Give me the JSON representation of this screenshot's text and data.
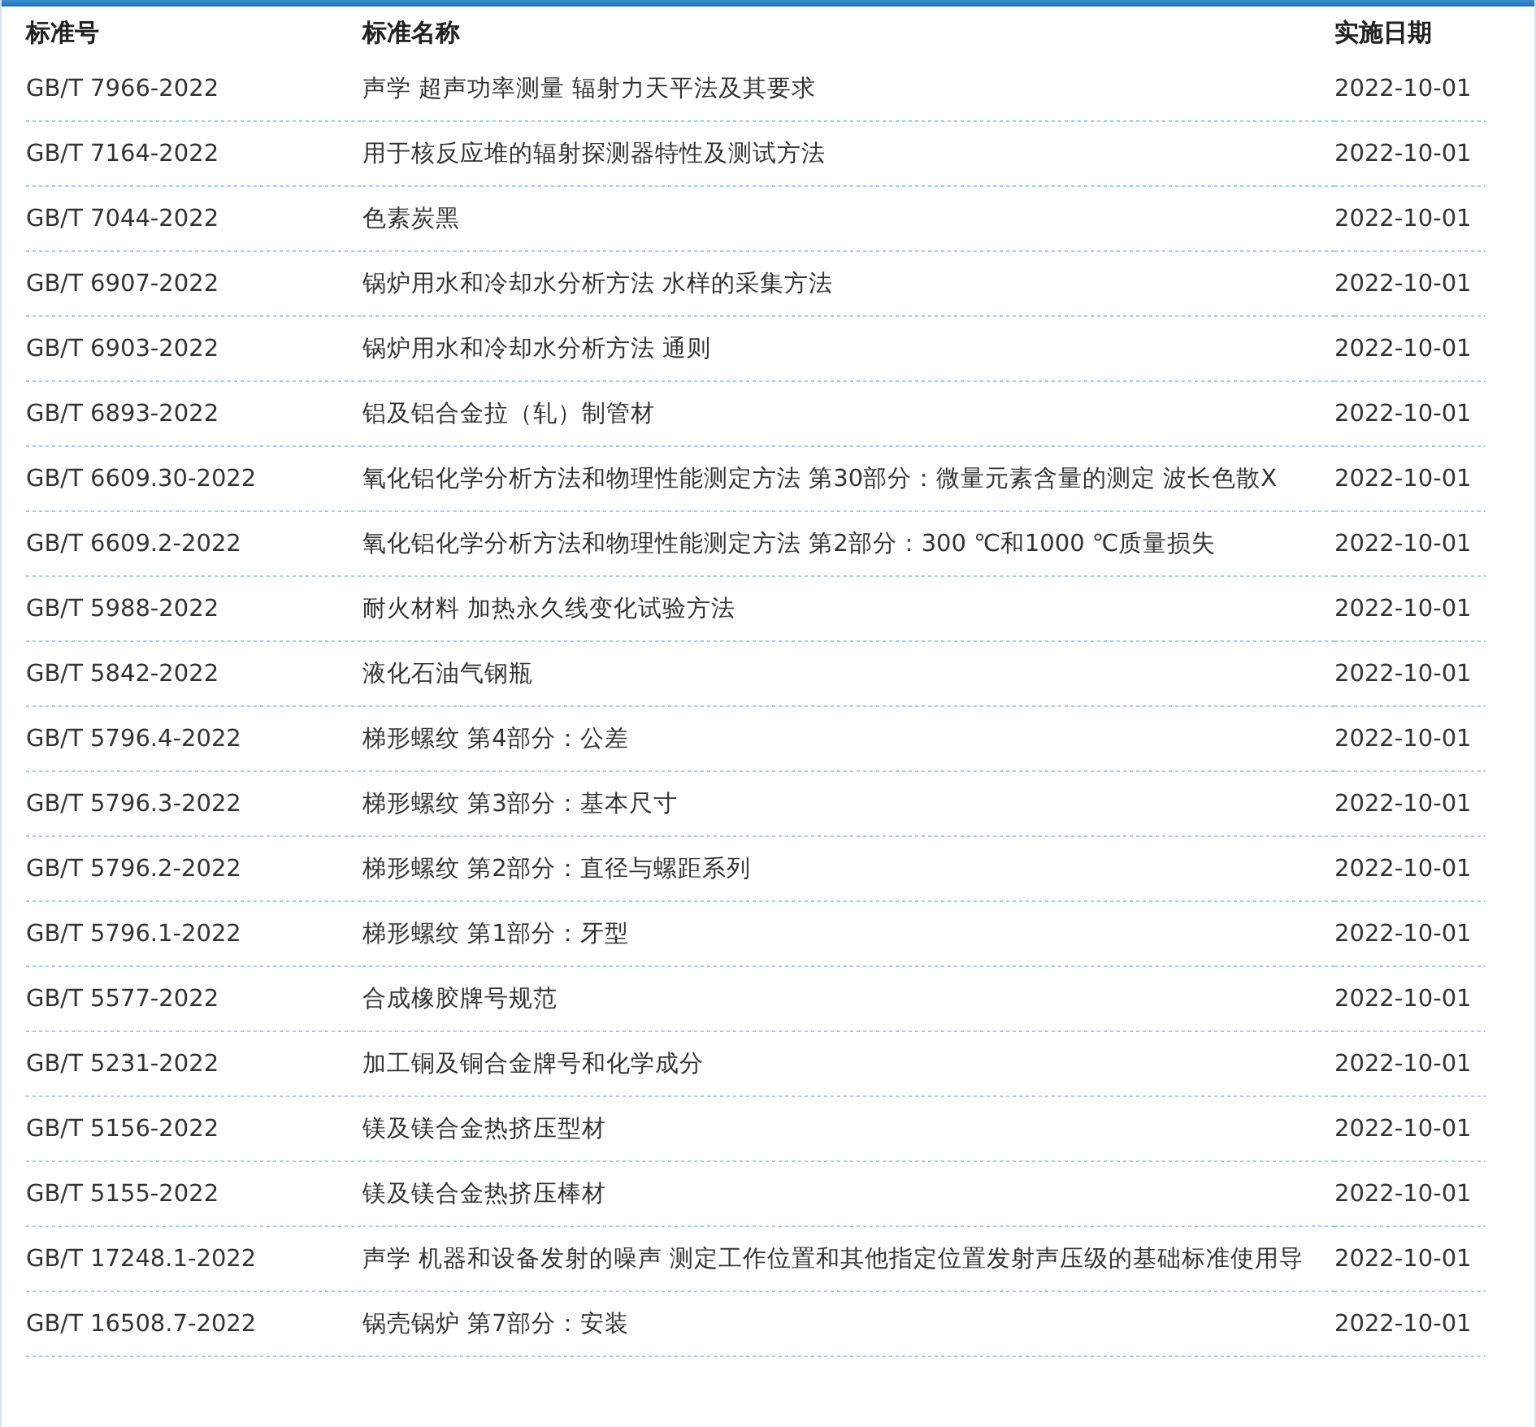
{
  "table": {
    "columns": [
      "标准号",
      "标准名称",
      "实施日期"
    ],
    "rows": [
      {
        "code": "GB/T 7966-2022",
        "name": "声学 超声功率测量 辐射力天平法及其要求",
        "date": "2022-10-01"
      },
      {
        "code": "GB/T 7164-2022",
        "name": "用于核反应堆的辐射探测器特性及测试方法",
        "date": "2022-10-01"
      },
      {
        "code": "GB/T 7044-2022",
        "name": "色素炭黑",
        "date": "2022-10-01"
      },
      {
        "code": "GB/T 6907-2022",
        "name": "锅炉用水和冷却水分析方法 水样的采集方法",
        "date": "2022-10-01"
      },
      {
        "code": "GB/T 6903-2022",
        "name": "锅炉用水和冷却水分析方法 通则",
        "date": "2022-10-01"
      },
      {
        "code": "GB/T 6893-2022",
        "name": "铝及铝合金拉（轧）制管材",
        "date": "2022-10-01"
      },
      {
        "code": "GB/T 6609.30-2022",
        "name": "氧化铝化学分析方法和物理性能测定方法 第30部分：微量元素含量的测定 波长色散X",
        "date": "2022-10-01"
      },
      {
        "code": "GB/T 6609.2-2022",
        "name": "氧化铝化学分析方法和物理性能测定方法 第2部分：300 ℃和1000 ℃质量损失",
        "date": "2022-10-01"
      },
      {
        "code": "GB/T 5988-2022",
        "name": "耐火材料 加热永久线变化试验方法",
        "date": "2022-10-01"
      },
      {
        "code": "GB/T 5842-2022",
        "name": "液化石油气钢瓶",
        "date": "2022-10-01"
      },
      {
        "code": "GB/T 5796.4-2022",
        "name": "梯形螺纹 第4部分：公差",
        "date": "2022-10-01"
      },
      {
        "code": "GB/T 5796.3-2022",
        "name": "梯形螺纹 第3部分：基本尺寸",
        "date": "2022-10-01"
      },
      {
        "code": "GB/T 5796.2-2022",
        "name": "梯形螺纹 第2部分：直径与螺距系列",
        "date": "2022-10-01"
      },
      {
        "code": "GB/T 5796.1-2022",
        "name": "梯形螺纹 第1部分：牙型",
        "date": "2022-10-01"
      },
      {
        "code": "GB/T 5577-2022",
        "name": "合成橡胶牌号规范",
        "date": "2022-10-01"
      },
      {
        "code": "GB/T 5231-2022",
        "name": "加工铜及铜合金牌号和化学成分",
        "date": "2022-10-01"
      },
      {
        "code": "GB/T 5156-2022",
        "name": "镁及镁合金热挤压型材",
        "date": "2022-10-01"
      },
      {
        "code": "GB/T 5155-2022",
        "name": "镁及镁合金热挤压棒材",
        "date": "2022-10-01"
      },
      {
        "code": "GB/T 17248.1-2022",
        "name": "声学 机器和设备发射的噪声 测定工作位置和其他指定位置发射声压级的基础标准使用导",
        "date": "2022-10-01"
      },
      {
        "code": "GB/T 16508.7-2022",
        "name": "锅壳锅炉 第7部分：安装",
        "date": "2022-10-01"
      }
    ]
  }
}
